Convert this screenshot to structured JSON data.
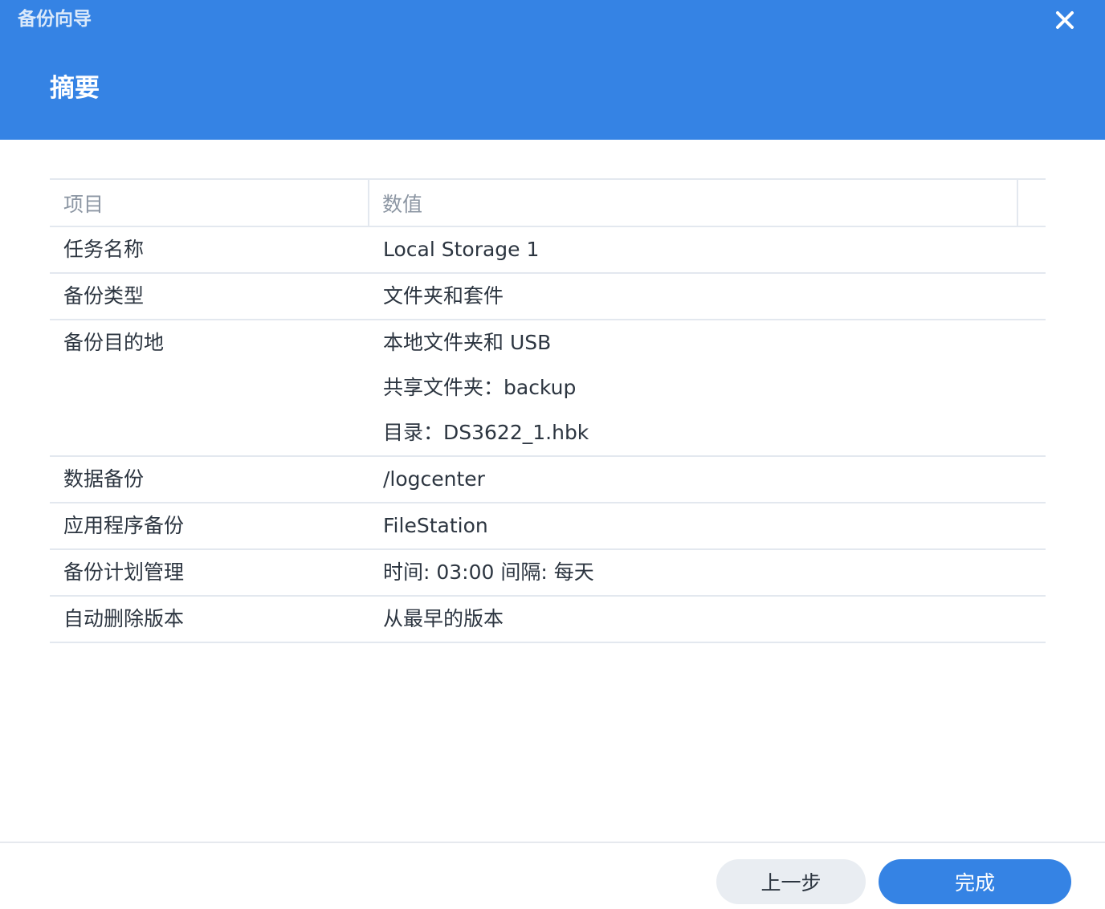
{
  "window": {
    "title": "备份向导",
    "close_icon": "close-icon"
  },
  "page": {
    "title": "摘要"
  },
  "table": {
    "headers": [
      "项目",
      "数值"
    ],
    "rows": [
      {
        "label": "任务名称",
        "values": [
          "Local Storage 1"
        ]
      },
      {
        "label": "备份类型",
        "values": [
          "文件夹和套件"
        ]
      },
      {
        "label": "备份目的地",
        "values": [
          "本地文件夹和 USB",
          "共享文件夹：backup",
          "目录：DS3622_1.hbk"
        ]
      },
      {
        "label": "数据备份",
        "values": [
          "/logcenter"
        ]
      },
      {
        "label": "应用程序备份",
        "values": [
          "FileStation"
        ]
      },
      {
        "label": "备份计划管理",
        "values": [
          "时间: 03:00 间隔: 每天"
        ]
      },
      {
        "label": "自动删除版本",
        "values": [
          "从最早的版本"
        ]
      }
    ]
  },
  "footer": {
    "back_label": "上一步",
    "finish_label": "完成"
  },
  "colors": {
    "accent": "#3583e4",
    "secondary_button": "#e9edf2",
    "divider": "#e3e8ef"
  }
}
